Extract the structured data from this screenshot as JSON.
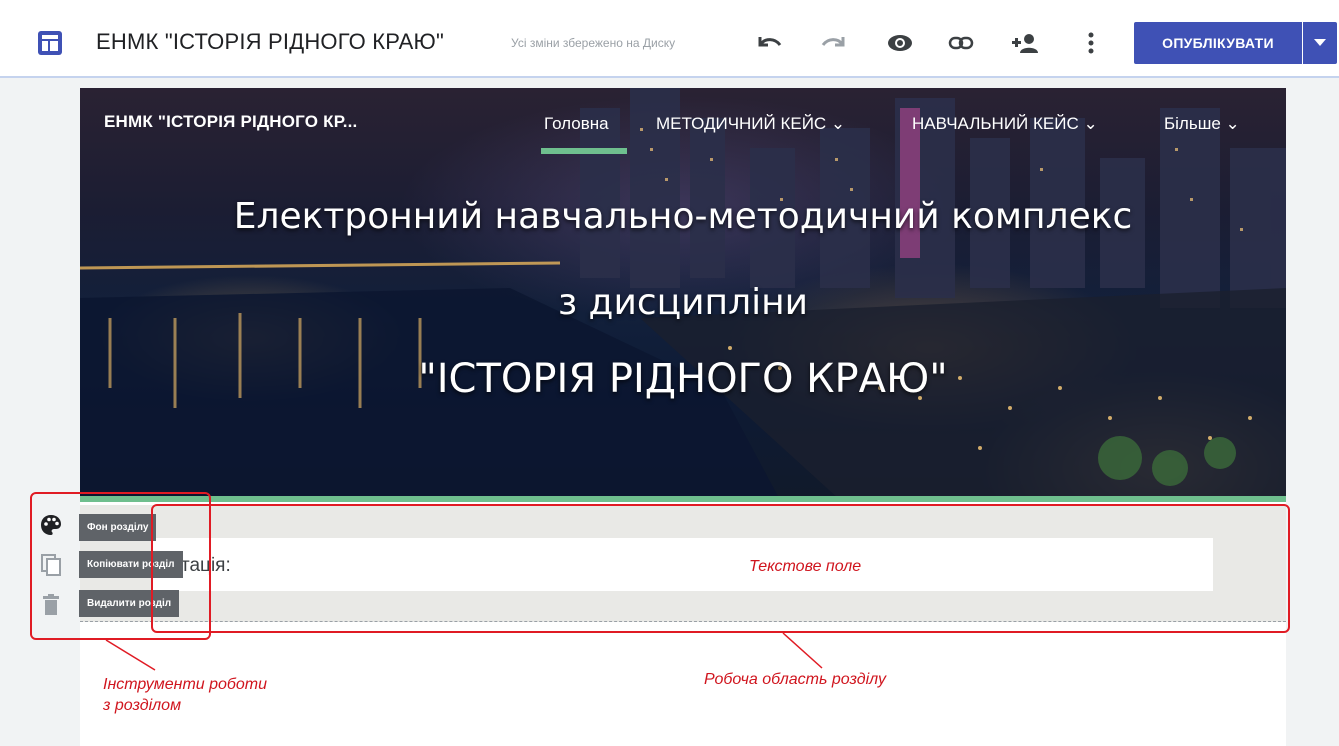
{
  "topbar": {
    "doc_title": "ЕНМК \"ІСТОРІЯ РІДНОГО КРАЮ\"",
    "save_status": "Усі зміни збережено на Диску",
    "publish_label": "ОПУБЛІКУВАТИ",
    "icons": [
      "app-layout-icon",
      "undo-icon",
      "redo-icon",
      "preview-icon",
      "link-icon",
      "add-person-icon",
      "more-vert-icon",
      "chevron-down-icon"
    ]
  },
  "site": {
    "name": "ЕНМК \"ІСТОРІЯ РІДНОГО КР...",
    "nav": [
      {
        "label": "Головна",
        "active": true
      },
      {
        "label": "МЕТОДИЧНИЙ КЕЙС ⌄"
      },
      {
        "label": "НАВЧАЛЬНИЙ КЕЙС ⌄"
      },
      {
        "label": "Більше ⌄"
      }
    ],
    "hero": {
      "line1": "Електронний навчально-методичний комплекс",
      "line2": "з дисципліни",
      "line3": "\"ІСТОРІЯ РІДНОГО КРАЮ\""
    }
  },
  "section": {
    "text": "тація:"
  },
  "tools": {
    "bg": "Фон розділу",
    "copy": "Копіювати розділ",
    "delete": "Видалити розділ"
  },
  "annotations": {
    "text_field": "Текстове поле",
    "tools_line1": "Інструменти роботи",
    "tools_line2": "з розділом",
    "work_area": "Робоча область розділу"
  },
  "colors": {
    "accent": "#3f51b5",
    "green_bar": "#6fbf8e",
    "annotation_red": "#e01b24"
  }
}
